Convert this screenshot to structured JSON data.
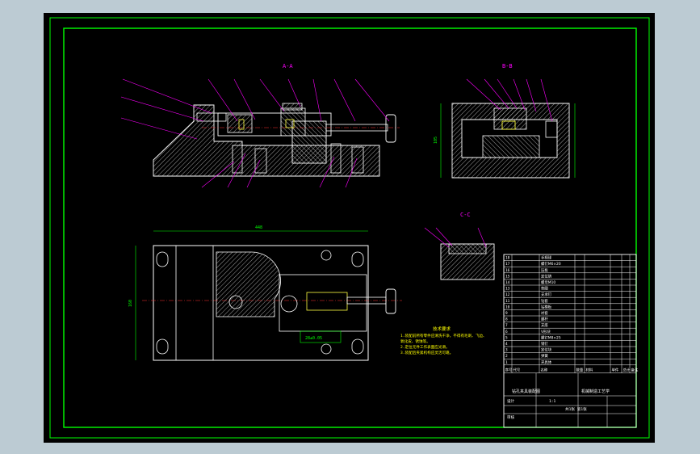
{
  "drawing": {
    "colors": {
      "frame_bg": "#bccbd3",
      "sheet_bg": "#000000",
      "border": "#00ff00",
      "outline": "#ffffff",
      "hatch": "#c8c8c8",
      "leader": "#ff00ff",
      "dimension": "#00ff00",
      "center_line": "#ff3030",
      "note": "#ffff00",
      "accent": "#ffff40"
    },
    "views": {
      "section_a": {
        "title": "A-A"
      },
      "section_b": {
        "title": "B-B"
      },
      "section_c": {
        "title": "C-C"
      }
    },
    "dimensions": {
      "plan_width": "448",
      "plan_height": "160",
      "section_b_height": "105",
      "plan_inner": "28±0.05"
    },
    "notes": {
      "heading": "技术要求",
      "lines": [
        "1.装配前所有零件应清洗干净，不得有毛刺、飞边、",
        "  氧化皮、锈蚀等。",
        "2.定位元件工作表面应光滑。",
        "3.装配后夹紧机构应灵活可靠。"
      ]
    },
    "title_block": {
      "parts_header": [
        "序号",
        "代号",
        "名称",
        "数量",
        "材料",
        "单件",
        "总计",
        "备注"
      ],
      "parts": [
        {
          "no": "18",
          "name": "手柄球"
        },
        {
          "no": "17",
          "name": "螺钉M6×20"
        },
        {
          "no": "16",
          "name": "压板"
        },
        {
          "no": "15",
          "name": "定位销"
        },
        {
          "no": "14",
          "name": "螺母M10"
        },
        {
          "no": "13",
          "name": "垫圈"
        },
        {
          "no": "12",
          "name": "支承钉"
        },
        {
          "no": "11",
          "name": "钻套"
        },
        {
          "no": "10",
          "name": "钻模板"
        },
        {
          "no": "9",
          "name": "衬套"
        },
        {
          "no": "8",
          "name": "螺杆"
        },
        {
          "no": "7",
          "name": "支座"
        },
        {
          "no": "6",
          "name": "V形块"
        },
        {
          "no": "5",
          "name": "螺钉M8×25"
        },
        {
          "no": "4",
          "name": "销钉"
        },
        {
          "no": "3",
          "name": "定位块"
        },
        {
          "no": "2",
          "name": "弹簧"
        },
        {
          "no": "1",
          "name": "夹具体"
        }
      ],
      "drawing_name": "钻孔夹具装配图",
      "company": "机械制造工艺学",
      "scale": "1:1",
      "sheet": "共1张 第1张",
      "designer": "设计",
      "checker": "审核"
    }
  }
}
